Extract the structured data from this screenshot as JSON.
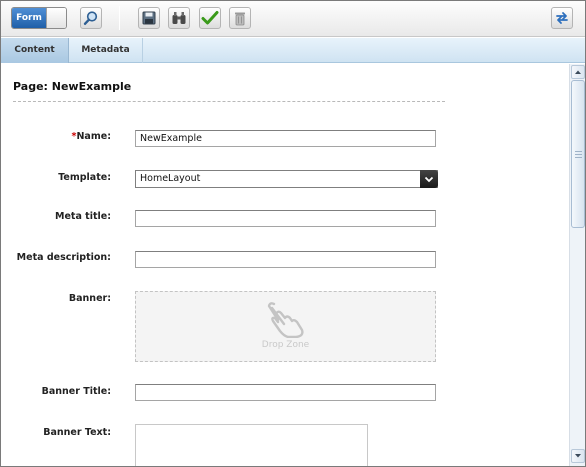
{
  "toolbar": {
    "mode_toggle_label": "Form",
    "buttons": [
      "search",
      "save",
      "binoculars",
      "approve",
      "delete",
      "refresh"
    ]
  },
  "tabs": [
    {
      "label": "Content",
      "active": true
    },
    {
      "label": "Metadata",
      "active": false
    }
  ],
  "page": {
    "title": "Page: NewExample"
  },
  "form": {
    "name": {
      "label": "Name:",
      "required_marker": "*",
      "value": "NewExample"
    },
    "template": {
      "label": "Template:",
      "value": "HomeLayout"
    },
    "meta_title": {
      "label": "Meta title:",
      "value": ""
    },
    "meta_description": {
      "label": "Meta description:",
      "value": ""
    },
    "banner": {
      "label": "Banner:",
      "drop_zone_text": "Drop Zone"
    },
    "banner_title": {
      "label": "Banner Title:",
      "value": ""
    },
    "banner_text": {
      "label": "Banner Text:",
      "value": ""
    }
  },
  "colors": {
    "toggle_active": "#2d6fbd",
    "tab_bar": "#d8e9f5",
    "required": "#cc0000",
    "approve_green": "#3a9a1a"
  }
}
